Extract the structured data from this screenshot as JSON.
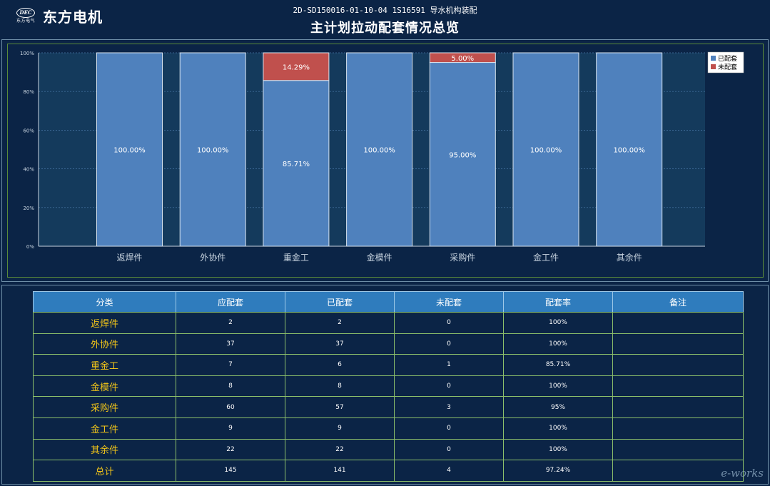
{
  "header": {
    "logo_emblem": "DEC",
    "logo_small": "东方电气",
    "company": "东方电机",
    "subtitle": "2D-SD150016-01-10-04    1S16591 导水机构装配",
    "title": "主计划拉动配套情况总览"
  },
  "chart_data": {
    "type": "bar",
    "stacked": true,
    "categories": [
      "返焊件",
      "外协件",
      "重金工",
      "金模件",
      "采购件",
      "金工件",
      "其余件"
    ],
    "series": [
      {
        "name": "已配套",
        "color": "#4f81bd",
        "values": [
          100,
          100,
          85.71,
          100,
          95,
          100,
          100
        ],
        "labels": [
          "100.00%",
          "100.00%",
          "85.71%",
          "100.00%",
          "95.00%",
          "100.00%",
          "100.00%"
        ]
      },
      {
        "name": "未配套",
        "color": "#c0504d",
        "values": [
          0,
          0,
          14.29,
          0,
          5,
          0,
          0
        ],
        "labels": [
          "",
          "",
          "14.29%",
          "",
          "5.00%",
          "",
          ""
        ]
      }
    ],
    "ylim": [
      0,
      100
    ],
    "yticks": [
      "0%",
      "20%",
      "40%",
      "60%",
      "80%",
      "100%"
    ],
    "grid": true,
    "legend": "top-right"
  },
  "table": {
    "headers": [
      "分类",
      "应配套",
      "已配套",
      "未配套",
      "配套率",
      "备注"
    ],
    "rows": [
      [
        "返焊件",
        "2",
        "2",
        "0",
        "100%",
        ""
      ],
      [
        "外协件",
        "37",
        "37",
        "0",
        "100%",
        ""
      ],
      [
        "重金工",
        "7",
        "6",
        "1",
        "85.71%",
        ""
      ],
      [
        "金模件",
        "8",
        "8",
        "0",
        "100%",
        ""
      ],
      [
        "采购件",
        "60",
        "57",
        "3",
        "95%",
        ""
      ],
      [
        "金工件",
        "9",
        "9",
        "0",
        "100%",
        ""
      ],
      [
        "其余件",
        "22",
        "22",
        "0",
        "100%",
        ""
      ],
      [
        "总计",
        "145",
        "141",
        "4",
        "97.24%",
        ""
      ]
    ]
  },
  "watermark": "e-works"
}
